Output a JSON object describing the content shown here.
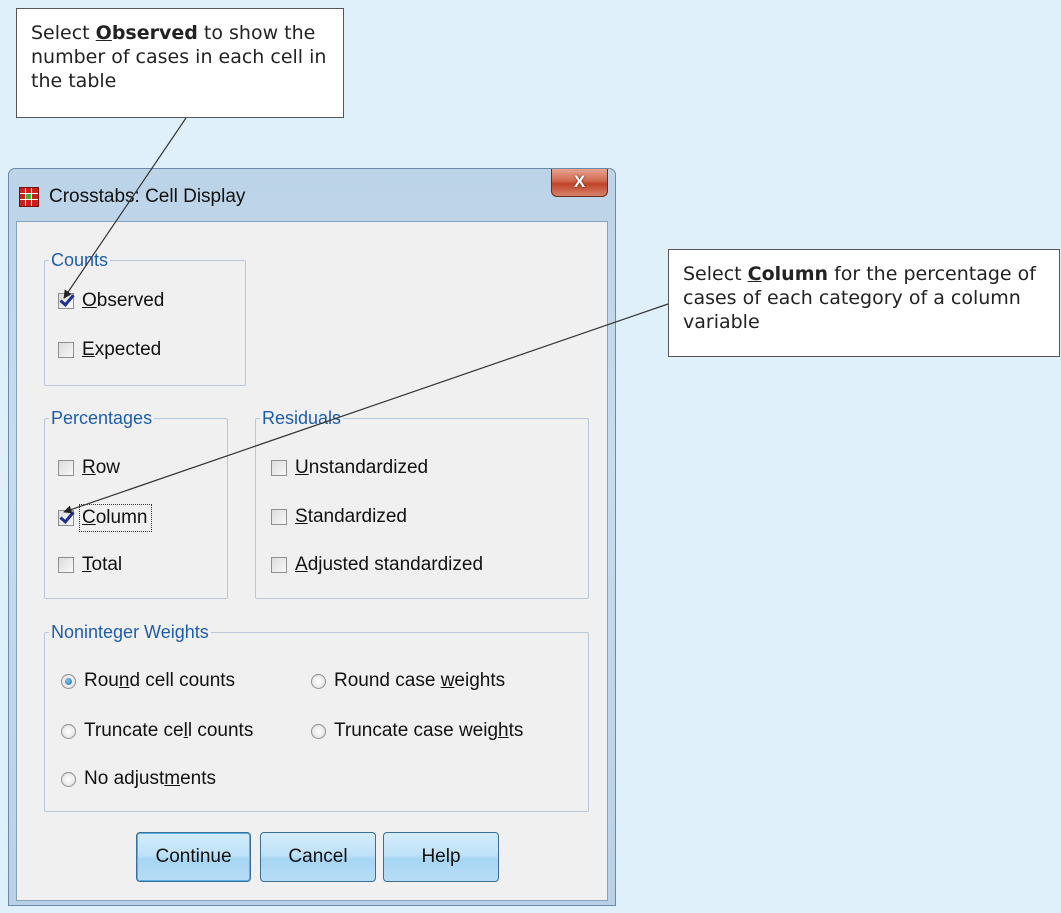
{
  "callouts": {
    "observed": {
      "prefix": "Select ",
      "keyword_first": "O",
      "keyword_rest": "bserved",
      "suffix": " to show the number of cases in each cell in the table"
    },
    "column": {
      "prefix": "Select ",
      "keyword_first": "C",
      "keyword_rest": "olumn",
      "suffix": " for the percentage of cases of each category of a column variable"
    }
  },
  "window": {
    "title": "Crosstabs: Cell Display",
    "close_label": "X"
  },
  "counts": {
    "legend": "Counts",
    "options": [
      {
        "label": "Observed",
        "checked": true
      },
      {
        "label": "Expected",
        "checked": false
      }
    ]
  },
  "percentages": {
    "legend": "Percentages",
    "options": [
      {
        "label": "Row",
        "checked": false
      },
      {
        "label": "Column",
        "checked": true
      },
      {
        "label": "Total",
        "checked": false
      }
    ]
  },
  "residuals": {
    "legend": "Residuals",
    "options": [
      {
        "label": "Unstandardized",
        "checked": false
      },
      {
        "label": "Standardized",
        "checked": false
      },
      {
        "label": "Adjusted standardized",
        "checked": false
      }
    ]
  },
  "weights": {
    "legend": "Noninteger Weights",
    "options": [
      {
        "label": "Round cell counts",
        "selected": true
      },
      {
        "label": "Round case weights",
        "selected": false
      },
      {
        "label": "Truncate cell counts",
        "selected": false
      },
      {
        "label": "Truncate case weights",
        "selected": false
      },
      {
        "label": "No adjustments",
        "selected": false
      }
    ]
  },
  "buttons": {
    "continue": "Continue",
    "cancel": "Cancel",
    "help": "Help"
  },
  "colors": {
    "background": "#dff0fb",
    "legend_text": "#1e5ea8",
    "check_mark": "#1f2f8a",
    "close_button": "#c14428"
  }
}
